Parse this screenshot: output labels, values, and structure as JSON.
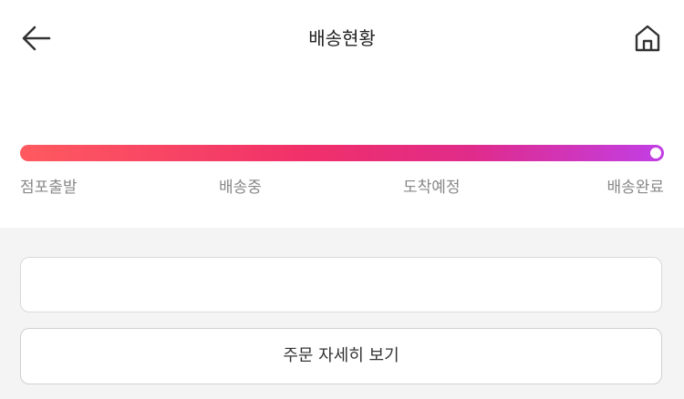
{
  "header": {
    "title": "배송현황",
    "back_icon": "arrow-left-icon",
    "home_icon": "home-icon"
  },
  "progress": {
    "level": 1.0,
    "steps": [
      "점포출발",
      "배송중",
      "도착예정",
      "배송완료"
    ],
    "gradient_colors": [
      "#ff5a5f",
      "#f0306a",
      "#e02b8a",
      "#c13fe6"
    ]
  },
  "actions": {
    "order_detail_label": "주문 자세히 보기"
  }
}
